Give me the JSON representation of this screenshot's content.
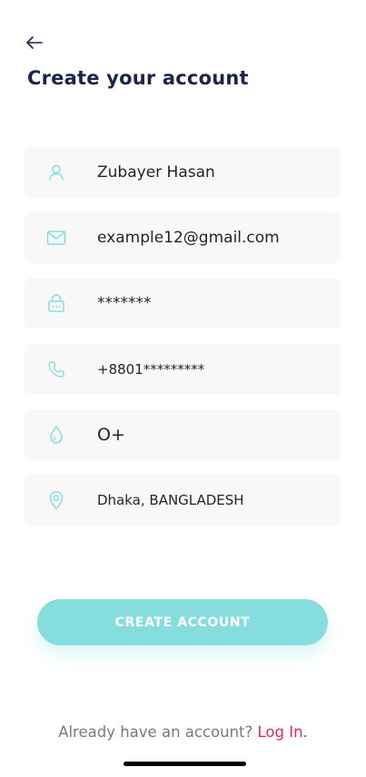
{
  "colors": {
    "accent": "#85dedd",
    "title": "#1b2449",
    "link": "#e8265e",
    "field_bg": "#f8f8f8"
  },
  "header": {
    "back_icon": "arrow-left-icon",
    "title": "Create your account"
  },
  "fields": {
    "name": {
      "icon": "user-icon",
      "value": "Zubayer Hasan"
    },
    "email": {
      "icon": "mail-icon",
      "value": "example12@gmail.com"
    },
    "password": {
      "icon": "lock-icon",
      "value": "*******"
    },
    "phone": {
      "icon": "phone-icon",
      "value": "+8801*********"
    },
    "blood_group": {
      "icon": "drop-icon",
      "value": "O+"
    },
    "location": {
      "icon": "location-pin-icon",
      "value": "Dhaka, BANGLADESH"
    }
  },
  "actions": {
    "create_account_label": "CREATE ACCOUNT"
  },
  "footer": {
    "prompt": "Already have an account?",
    "login_link": "Log In."
  }
}
